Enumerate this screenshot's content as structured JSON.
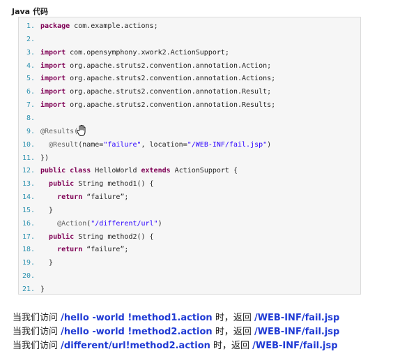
{
  "code_title": "Java 代码",
  "code_lines": [
    {
      "n": "1.",
      "segments": [
        {
          "t": "package",
          "c": "kw"
        },
        {
          "t": " com.example.actions;",
          "c": "tx"
        }
      ]
    },
    {
      "n": "2.",
      "segments": []
    },
    {
      "n": "3.",
      "segments": [
        {
          "t": "import",
          "c": "kw"
        },
        {
          "t": " com.opensymphony.xwork2.ActionSupport;",
          "c": "tx"
        }
      ]
    },
    {
      "n": "4.",
      "segments": [
        {
          "t": "import",
          "c": "kw"
        },
        {
          "t": " org.apache.struts2.convention.annotation.Action;",
          "c": "tx"
        }
      ]
    },
    {
      "n": "5.",
      "segments": [
        {
          "t": "import",
          "c": "kw"
        },
        {
          "t": " org.apache.struts2.convention.annotation.Actions;",
          "c": "tx"
        }
      ]
    },
    {
      "n": "6.",
      "segments": [
        {
          "t": "import",
          "c": "kw"
        },
        {
          "t": " org.apache.struts2.convention.annotation.Result;",
          "c": "tx"
        }
      ]
    },
    {
      "n": "7.",
      "segments": [
        {
          "t": "import",
          "c": "kw"
        },
        {
          "t": " org.apache.struts2.convention.annotation.Results;",
          "c": "tx"
        }
      ]
    },
    {
      "n": "8.",
      "segments": []
    },
    {
      "n": "9.",
      "segments": [
        {
          "t": "@Results(",
          "c": "an"
        }
      ]
    },
    {
      "n": "10.",
      "segments": [
        {
          "t": "  @Result",
          "c": "an"
        },
        {
          "t": "(name=",
          "c": "tx"
        },
        {
          "t": "\"failure\"",
          "c": "st"
        },
        {
          "t": ", location=",
          "c": "tx"
        },
        {
          "t": "\"/WEB-INF/fail.jsp\"",
          "c": "st"
        },
        {
          "t": ")",
          "c": "tx"
        }
      ]
    },
    {
      "n": "11.",
      "segments": [
        {
          "t": "})",
          "c": "tx"
        }
      ]
    },
    {
      "n": "12.",
      "segments": [
        {
          "t": "public class",
          "c": "kw"
        },
        {
          "t": " HelloWorld ",
          "c": "tx"
        },
        {
          "t": "extends",
          "c": "kw"
        },
        {
          "t": " ActionSupport {",
          "c": "tx"
        }
      ]
    },
    {
      "n": "13.",
      "segments": [
        {
          "t": "  ",
          "c": "tx"
        },
        {
          "t": "public",
          "c": "kw"
        },
        {
          "t": " String method1() {",
          "c": "tx"
        }
      ]
    },
    {
      "n": "14.",
      "segments": [
        {
          "t": "    ",
          "c": "tx"
        },
        {
          "t": "return",
          "c": "kw"
        },
        {
          "t": " “failure”;",
          "c": "tx"
        }
      ]
    },
    {
      "n": "15.",
      "segments": [
        {
          "t": "  }",
          "c": "tx"
        }
      ]
    },
    {
      "n": "16.",
      "segments": [
        {
          "t": "    @Action",
          "c": "an"
        },
        {
          "t": "(",
          "c": "tx"
        },
        {
          "t": "\"/different/url\"",
          "c": "st"
        },
        {
          "t": ")",
          "c": "tx"
        }
      ]
    },
    {
      "n": "17.",
      "segments": [
        {
          "t": "  ",
          "c": "tx"
        },
        {
          "t": "public",
          "c": "kw"
        },
        {
          "t": " String method2() {",
          "c": "tx"
        }
      ]
    },
    {
      "n": "18.",
      "segments": [
        {
          "t": "    ",
          "c": "tx"
        },
        {
          "t": "return",
          "c": "kw"
        },
        {
          "t": " “failure”;",
          "c": "tx"
        }
      ]
    },
    {
      "n": "19.",
      "segments": [
        {
          "t": "  }",
          "c": "tx"
        }
      ]
    },
    {
      "n": "20.",
      "segments": []
    },
    {
      "n": "21.",
      "segments": [
        {
          "t": "}",
          "c": "tx"
        }
      ]
    }
  ],
  "hand_icon": "hand-cursor-icon",
  "descriptions": [
    {
      "prefix": "当我们访问 ",
      "url": "/hello -world !method1.action",
      "middle": " 时，返回 ",
      "target": "/WEB-INF/fail.jsp"
    },
    {
      "prefix": "当我们访问 ",
      "url": "/hello -world !method2.action",
      "middle": " 时，返回 ",
      "target": "/WEB-INF/fail.jsp"
    },
    {
      "prefix": "当我们访问 ",
      "url": "/different/url!method2.action",
      "middle": " 时，返回 ",
      "target": "/WEB-INF/fail.jsp"
    }
  ],
  "colors": {
    "keyword": "#7f0055",
    "annotation": "#646464",
    "string": "#2a00ff",
    "line_number": "#2b91af",
    "link": "#1f3ad4"
  }
}
